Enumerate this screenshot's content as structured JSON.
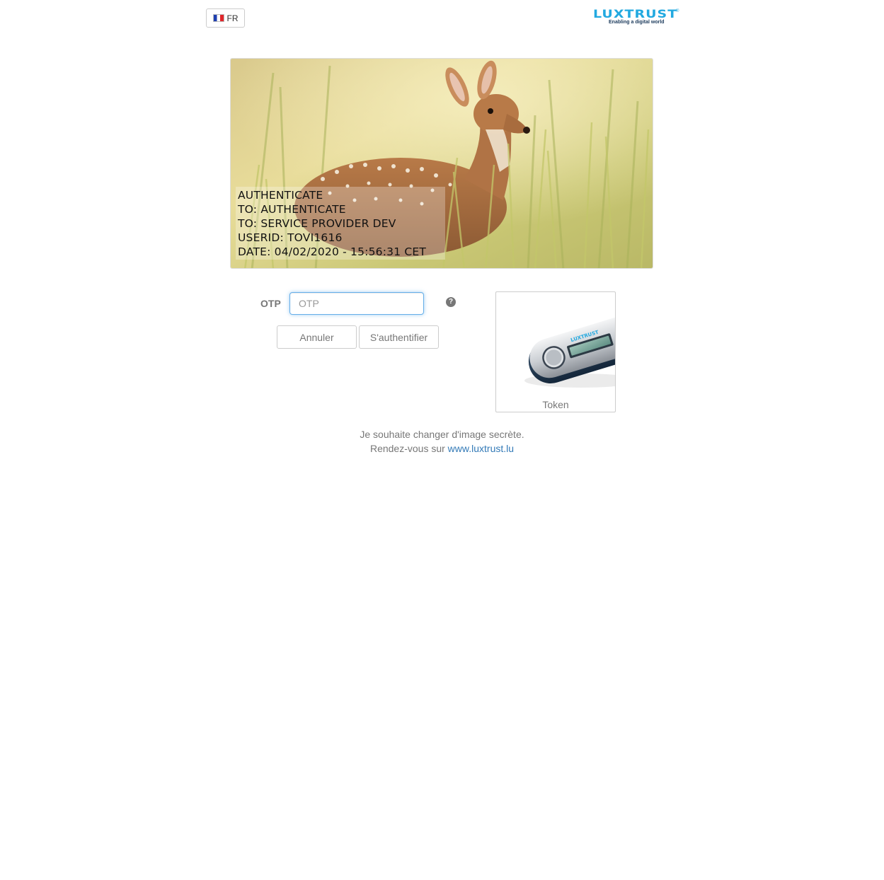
{
  "header": {
    "language_label": "FR",
    "logo_text": "LUXTRUST",
    "logo_tagline": "Enabling a digital world",
    "logo_registered": "®"
  },
  "secret_image": {
    "description_icon": "deer-photo",
    "lines": [
      "AUTHENTICATE",
      "TO: AUTHENTICATE",
      "TO: SERVICE PROVIDER DEV",
      "USERID: TOVI1616",
      "DATE: 04/02/2020 - 15:56:31 CET"
    ]
  },
  "otp": {
    "label": "OTP",
    "placeholder": "OTP",
    "value": "",
    "help_icon": "question-circle-icon",
    "help_glyph": "?"
  },
  "buttons": {
    "cancel_label": "Annuler",
    "authenticate_label": "S'authentifier"
  },
  "token": {
    "caption": "Token",
    "device_brand": "LUXTRUST"
  },
  "footer": {
    "line1": "Je souhaite changer d'image secrète.",
    "line2_prefix": "Rendez-vous sur",
    "link_text": "www.luxtrust.lu"
  },
  "colors": {
    "brand": "#22a9e0",
    "link": "#337ab7",
    "text_muted": "#777777",
    "focus_border": "#66afe9"
  }
}
